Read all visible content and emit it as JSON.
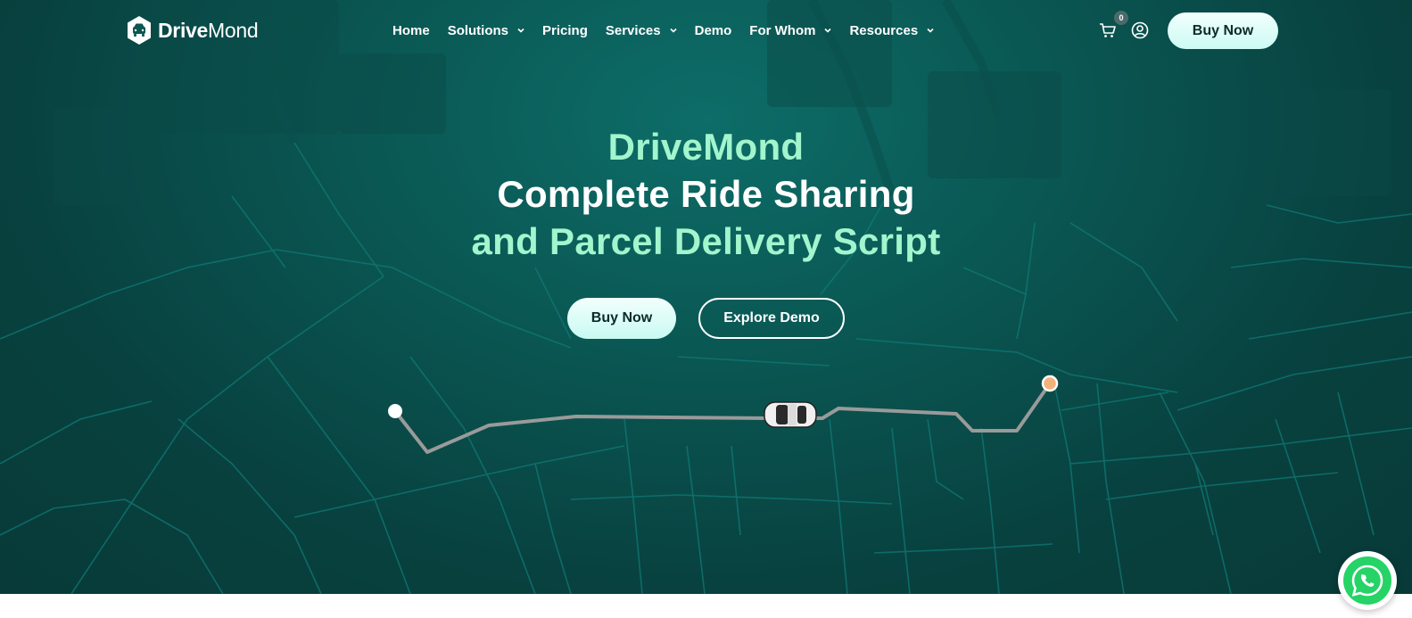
{
  "brand": {
    "name_bold": "Drive",
    "name_light": "Mond",
    "logo_icon": "car-hexagon-icon",
    "accent_color": "#a2f5cc"
  },
  "nav": {
    "items": [
      {
        "label": "Home",
        "dropdown": false
      },
      {
        "label": "Solutions",
        "dropdown": true
      },
      {
        "label": "Pricing",
        "dropdown": false
      },
      {
        "label": "Services",
        "dropdown": true
      },
      {
        "label": "Demo",
        "dropdown": false
      },
      {
        "label": "For Whom",
        "dropdown": true
      },
      {
        "label": "Resources",
        "dropdown": true
      }
    ]
  },
  "header_actions": {
    "cart_icon": "cart-icon",
    "cart_count": "0",
    "user_icon": "user-circle-icon",
    "buy_label": "Buy Now"
  },
  "hero": {
    "line1": "DriveMond",
    "line2": "Complete Ride Sharing",
    "line3": "and Parcel Delivery Script",
    "buy_label": "Buy Now",
    "demo_label": "Explore Demo",
    "route_icons": [
      "start-point-icon",
      "car-icon",
      "destination-point-icon"
    ]
  },
  "floating": {
    "whatsapp_icon": "whatsapp-icon",
    "whatsapp_color": "#25d366"
  }
}
